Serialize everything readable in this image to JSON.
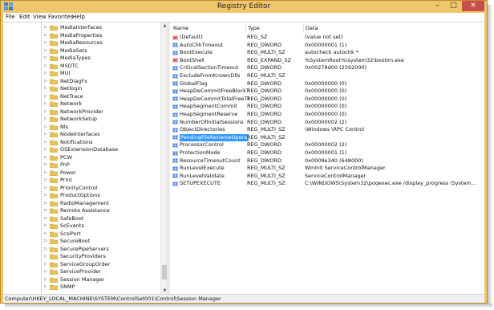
{
  "window": {
    "title": "Registry Editor"
  },
  "window_controls": {
    "minimize": "–",
    "maximize": "□",
    "close": "✕"
  },
  "menu": [
    "File",
    "Edit",
    "View",
    "Favorites",
    "Help"
  ],
  "tree": {
    "items": [
      "MediaInterfaces",
      "MediaProperties",
      "MediaResources",
      "MediaSets",
      "MediaTypes",
      "MSDTC",
      "MUI",
      "NetDiagFx",
      "Netlogin",
      "NetTrace",
      "Network",
      "NetworkProvider",
      "NetworkSetup",
      "Nls",
      "NodeInterfaces",
      "Notifications",
      "OSExtensionDatabase",
      "PCW",
      "PnP",
      "Power",
      "Print",
      "PriorityControl",
      "ProductOptions",
      "RadioManagement",
      "Remote Assistance",
      "SafeBoot",
      "ScEvents",
      "ScsiPort",
      "SecureBoot",
      "SecurePipeServers",
      "SecurityProviders",
      "ServiceGroupOrder",
      "ServiceProvider",
      "Session Manager",
      "SNMP"
    ],
    "expander_glyph": "▷"
  },
  "list": {
    "headers": {
      "name": "Name",
      "type": "Type",
      "data": "Data"
    },
    "rows": [
      {
        "name": "(Default)",
        "type": "REG_SZ",
        "data": "(value not set)",
        "kind": "sz"
      },
      {
        "name": "AutoChkTimeout",
        "type": "REG_DWORD",
        "data": "0x00000001 (1)",
        "kind": "bin"
      },
      {
        "name": "BootExecute",
        "type": "REG_MULTI_SZ",
        "data": "autocheck autochk *",
        "kind": "bin"
      },
      {
        "name": "BootShell",
        "type": "REG_EXPAND_SZ",
        "data": "%SystemRoot%\\system32\\bootim.exe",
        "kind": "sz"
      },
      {
        "name": "CriticalSectionTimeout",
        "type": "REG_DWORD",
        "data": "0x00278d00 (2592000)",
        "kind": "bin"
      },
      {
        "name": "ExcludeFromKnownDlls",
        "type": "REG_MULTI_SZ",
        "data": "",
        "kind": "bin"
      },
      {
        "name": "GlobalFlag",
        "type": "REG_DWORD",
        "data": "0x00000000 (0)",
        "kind": "bin"
      },
      {
        "name": "HeapDeCommitFreeBlockThr...",
        "type": "REG_DWORD",
        "data": "0x00000000 (0)",
        "kind": "bin"
      },
      {
        "name": "HeapDeCommitTotalFreeThr...",
        "type": "REG_DWORD",
        "data": "0x00000000 (0)",
        "kind": "bin"
      },
      {
        "name": "HeapSegmentCommit",
        "type": "REG_DWORD",
        "data": "0x00000000 (0)",
        "kind": "bin"
      },
      {
        "name": "HeapSegmentReserve",
        "type": "REG_DWORD",
        "data": "0x00000000 (0)",
        "kind": "bin"
      },
      {
        "name": "NumberOfInitialSessions",
        "type": "REG_DWORD",
        "data": "0x00000002 (2)",
        "kind": "bin"
      },
      {
        "name": "ObjectDirectories",
        "type": "REG_MULTI_SZ",
        "data": "\\Windows \\RPC Control",
        "kind": "bin"
      },
      {
        "name": "PendingFileRenameOperations",
        "type": "REG_MULTI_SZ",
        "data": "",
        "kind": "bin",
        "selected": true
      },
      {
        "name": "ProcessorControl",
        "type": "REG_DWORD",
        "data": "0x00000002 (2)",
        "kind": "bin"
      },
      {
        "name": "ProtectionMode",
        "type": "REG_DWORD",
        "data": "0x00000001 (1)",
        "kind": "bin"
      },
      {
        "name": "ResourceTimeoutCount",
        "type": "REG_DWORD",
        "data": "0x0009e340 (648000)",
        "kind": "bin"
      },
      {
        "name": "RunLevelExecute",
        "type": "REG_MULTI_SZ",
        "data": "WinInit ServiceControlManager",
        "kind": "bin"
      },
      {
        "name": "RunLevelValidate",
        "type": "REG_MULTI_SZ",
        "data": "ServiceControlManager",
        "kind": "bin"
      },
      {
        "name": "SETUPEXECUTE",
        "type": "REG_MULTI_SZ",
        "data": "C:\\WINDOWS\\System32\\poqexec.exe /display_progress \\System...",
        "kind": "bin"
      }
    ]
  },
  "status_bar": {
    "path": "Computer\\HKEY_LOCAL_MACHINE\\SYSTEM\\ControlSet001\\Control\\Session Manager"
  },
  "colors": {
    "frame": "#f0c66a",
    "selection": "#3399ff",
    "folder": "#e8c35a",
    "close_button": "#c7504a"
  }
}
